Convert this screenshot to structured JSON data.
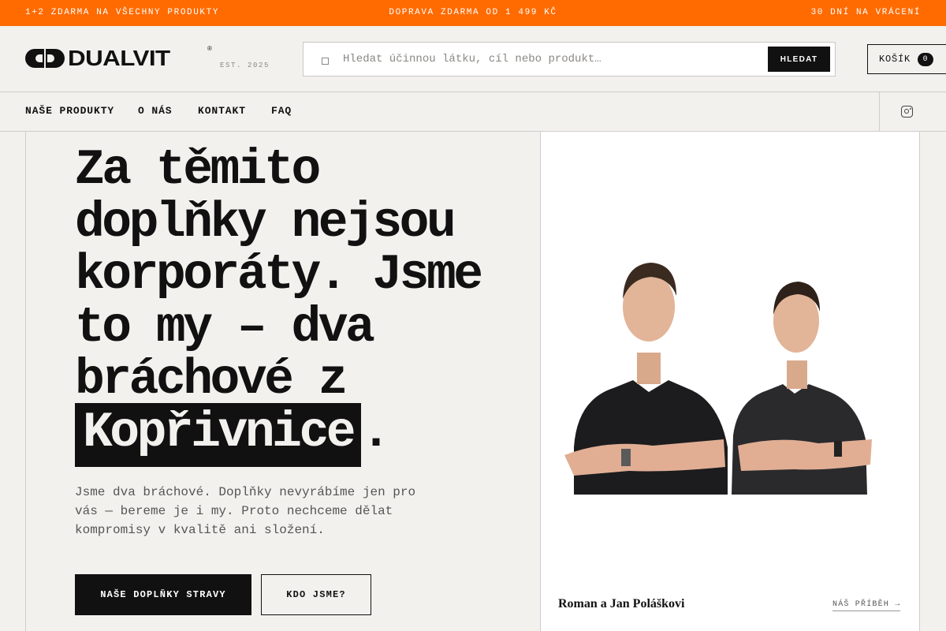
{
  "promo": {
    "left": "1+2 ZDARMA NA VŠECHNY PRODUKTY",
    "center": "DOPRAVA ZDARMA OD 1 499 KČ",
    "right": "30 DNÍ NA VRÁCENÍ",
    "background": "#ff6b00"
  },
  "header": {
    "logo": {
      "wordmark": "DUALVIT",
      "registered": "®",
      "tagline": "EST. 2025"
    },
    "search": {
      "placeholder": "Hledat účinnou látku, cíl nebo produkt…",
      "button_label": "HLEDAT",
      "icon": "search-icon"
    },
    "cart": {
      "label": "KOŠÍK",
      "count": "0"
    }
  },
  "nav": {
    "items": [
      {
        "label": "NAŠE PRODUKTY"
      },
      {
        "label": "O NÁS"
      },
      {
        "label": "KONTAKT"
      },
      {
        "label": "FAQ"
      }
    ],
    "social_icon": "instagram-icon"
  },
  "hero": {
    "title_main": "Za těmito doplňky nejsou korporáty. Jsme to my – dva bráchové z",
    "title_highlight": "Kopřivnice",
    "title_end": ".",
    "subtitle": "Jsme dva bráchové. Doplňky nevyrábíme jen pro vás — bereme je i my. Proto nechceme dělat kompromisy v kvalitě ani složení.",
    "primary_button": "NAŠE DOPLŇKY STRAVY",
    "secondary_button": "KDO JSME?",
    "photo_caption": "Roman a Jan Poláškovi",
    "photo_link": "NÁŠ PŘÍBĚH →"
  }
}
